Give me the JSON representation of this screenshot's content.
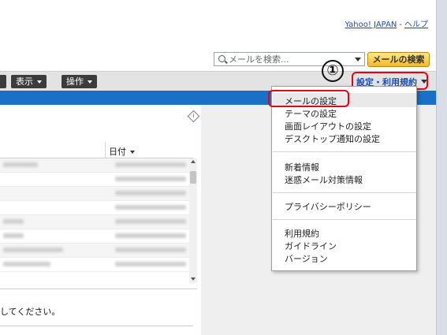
{
  "top_links": {
    "yahoo": "Yahoo! JAPAN",
    "sep": "-",
    "help": "ヘルプ"
  },
  "search": {
    "placeholder": "メールを検索...",
    "button": "メールの検索"
  },
  "toolbar": {
    "view": "表示",
    "action": "操作"
  },
  "settings": {
    "label": "設定・利用規約",
    "step": "①"
  },
  "list": {
    "date_header": "日付",
    "notice": "してください。"
  },
  "menu": {
    "groups": [
      [
        "メールの設定",
        "テーマの設定",
        "画面レイアウトの設定",
        "デスクトップ通知の設定"
      ],
      [
        "新着情報",
        "迷惑メール対策情報"
      ],
      [
        "プライバシーポリシー"
      ],
      [
        "利用規約",
        "ガイドライン",
        "バージョン"
      ]
    ]
  },
  "colors": {
    "highlight": "#e60012",
    "link": "#1a4db3",
    "band": "#1a6fc6",
    "button": "#f2b92c"
  }
}
